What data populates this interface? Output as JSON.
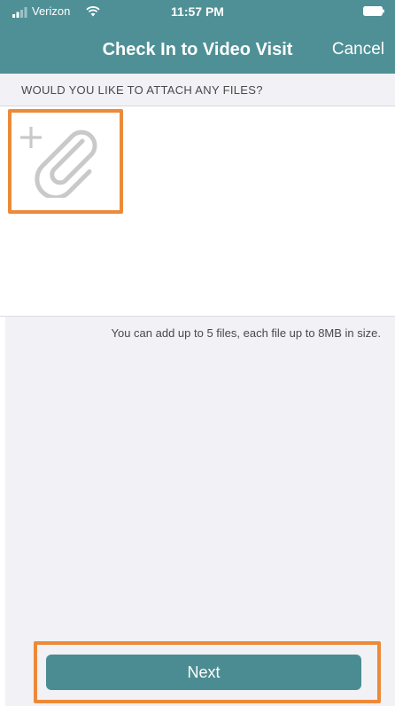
{
  "status_bar": {
    "carrier": "Verizon",
    "time": "11:57 PM",
    "signal_icon": "signal-bars-icon",
    "wifi_icon": "wifi-icon",
    "battery_icon": "battery-icon"
  },
  "nav": {
    "title": "Check In to Video Visit",
    "cancel_label": "Cancel"
  },
  "section": {
    "header": "WOULD YOU LIKE TO ATTACH ANY FILES?"
  },
  "attachment": {
    "icon": "add-attachment-paperclip-icon",
    "help_text": "You can add up to 5 files, each file up to 8MB in size."
  },
  "footer": {
    "next_label": "Next"
  },
  "colors": {
    "header_bg": "#4e9096",
    "button_bg": "#4b8c92",
    "highlight": "#ec8a3a",
    "page_bg": "#f1f1f6"
  }
}
